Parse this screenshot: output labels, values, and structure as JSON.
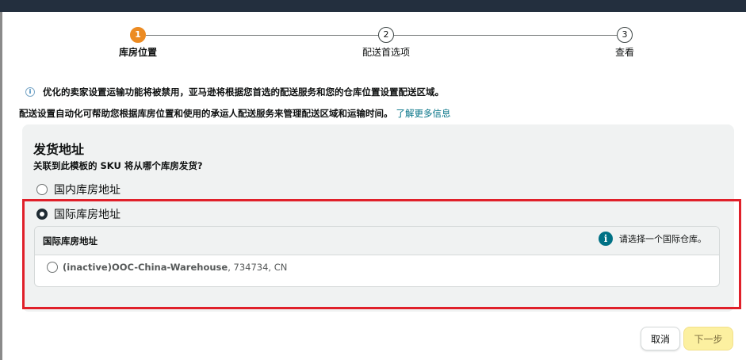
{
  "stepper": {
    "steps": [
      {
        "number": "1",
        "label": "库房位置",
        "state": "active"
      },
      {
        "number": "2",
        "label": "配送首选项",
        "state": "pending"
      },
      {
        "number": "3",
        "label": "查看",
        "state": "pending"
      }
    ]
  },
  "notice": {
    "icon": "info-icon",
    "text": "优化的卖家设置运输功能将被禁用，亚马逊将根据您首选的配送服务和您的仓库位置设置配送区域。"
  },
  "description": {
    "text": "配送设置自动化可帮助您根据库房位置和使用的承运人配送服务来管理配送区域和运输时间。",
    "link": "了解更多信息"
  },
  "ship_from": {
    "title": "发货地址",
    "question": "关联到此模板的 SKU 将从哪个库房发货?",
    "options": [
      {
        "label": "国内库房地址",
        "selected": false
      },
      {
        "label": "国际库房地址",
        "selected": true
      }
    ],
    "international": {
      "header": "国际库房地址",
      "hint": "请选择一个国际仓库。",
      "hint_icon": "info-icon",
      "warehouses": [
        {
          "name": "(inactive)OOC-China-Warehouse",
          "details": ", 734734, CN",
          "selected": false
        }
      ]
    }
  },
  "buttons": {
    "cancel": "取消",
    "next": "下一步"
  },
  "colors": {
    "active_step": "#ec8b22",
    "link": "#007185",
    "highlight_border": "#e0202a",
    "next_button_bg": "#fcf0a0"
  }
}
